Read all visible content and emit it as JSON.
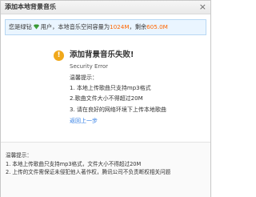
{
  "dialog": {
    "title": "添加本地背景音乐",
    "close_glyph": "×"
  },
  "infobar": {
    "prefix": "您是绿钻",
    "icon": "green-diamond-icon",
    "middle": "用户，本地音乐空间容量为",
    "capacity": "1024M",
    "sep": "，剩余",
    "remaining": "605.0M"
  },
  "error": {
    "icon": "warning-icon",
    "title": "添加背景音乐失败!",
    "subtitle": "Security Error",
    "tips_heading": "温馨提示：",
    "tips": [
      "1. 本地上传歌曲只支持mp3格式",
      "2.歌曲文件大小不得超过20M",
      "3. 请在良好的网络环境下上传本地歌曲"
    ],
    "back_label": "返回上一步"
  },
  "footer": {
    "heading": "温馨提示：",
    "lines": [
      "1. 本地上传歌曲只支持mp3格式，文件大小不得超过20M",
      "2. 上传的文件需保证未侵犯他人著作权，腾讯公司不负责断权相关问题"
    ]
  },
  "colors": {
    "accent_orange": "#ff6600",
    "link_blue": "#2d7be5",
    "warning_orange": "#f0a81b",
    "info_bg": "#eaf5ff"
  }
}
